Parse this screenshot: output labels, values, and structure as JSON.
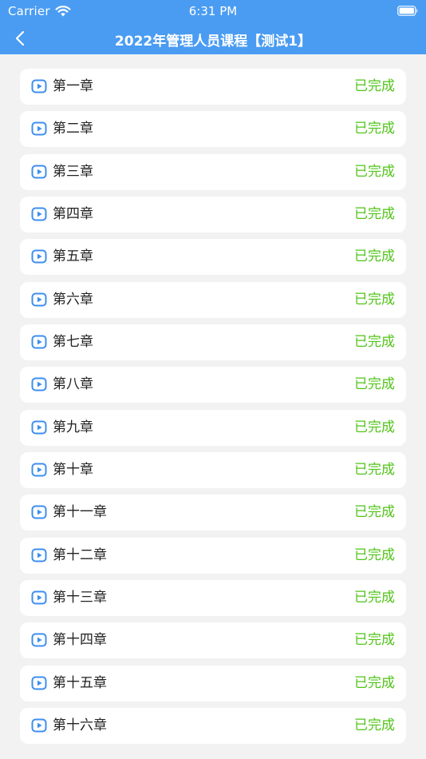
{
  "status_bar": {
    "carrier": "Carrier",
    "time": "6:31 PM"
  },
  "nav": {
    "title": "2022年管理人员课程【测试1】",
    "back_icon": "chevron-left-icon"
  },
  "colors": {
    "header_bg": "#4a9cf2",
    "page_bg": "#f2f2f2",
    "status_done": "#52c41a",
    "play_icon": "#3d8ef0"
  },
  "chapters": [
    {
      "title": "第一章",
      "status": "已完成"
    },
    {
      "title": "第二章",
      "status": "已完成"
    },
    {
      "title": "第三章",
      "status": "已完成"
    },
    {
      "title": "第四章",
      "status": "已完成"
    },
    {
      "title": "第五章",
      "status": "已完成"
    },
    {
      "title": "第六章",
      "status": "已完成"
    },
    {
      "title": "第七章",
      "status": "已完成"
    },
    {
      "title": "第八章",
      "status": "已完成"
    },
    {
      "title": "第九章",
      "status": "已完成"
    },
    {
      "title": "第十章",
      "status": "已完成"
    },
    {
      "title": "第十一章",
      "status": "已完成"
    },
    {
      "title": "第十二章",
      "status": "已完成"
    },
    {
      "title": "第十三章",
      "status": "已完成"
    },
    {
      "title": "第十四章",
      "status": "已完成"
    },
    {
      "title": "第十五章",
      "status": "已完成"
    },
    {
      "title": "第十六章",
      "status": "已完成"
    }
  ]
}
